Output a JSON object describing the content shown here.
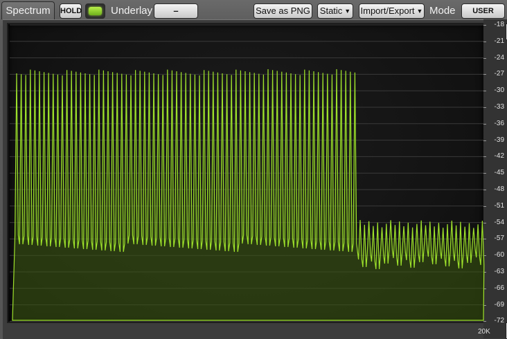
{
  "toolbar": {
    "tab_label": "Spectrum",
    "hold_label": "HOLD",
    "underlay_label": "Underlay",
    "underlay_value": "–",
    "save_label": "Save as PNG",
    "static_label": "Static",
    "import_label": "Import/Export",
    "mode_label": "Mode",
    "mode_value": "USER"
  },
  "graph": {
    "db_labels": [
      "-18",
      "-21",
      "-24",
      "-27",
      "-30",
      "-33",
      "-36",
      "-39",
      "-42",
      "-45",
      "-48",
      "-51",
      "-54",
      "-57",
      "-60",
      "-63",
      "-66",
      "-69",
      "-72"
    ],
    "freq_label": "20K",
    "colors": {
      "trace": "#9ee22b",
      "fill": "#3d5a10",
      "grid": "#3a3a3a"
    }
  }
}
